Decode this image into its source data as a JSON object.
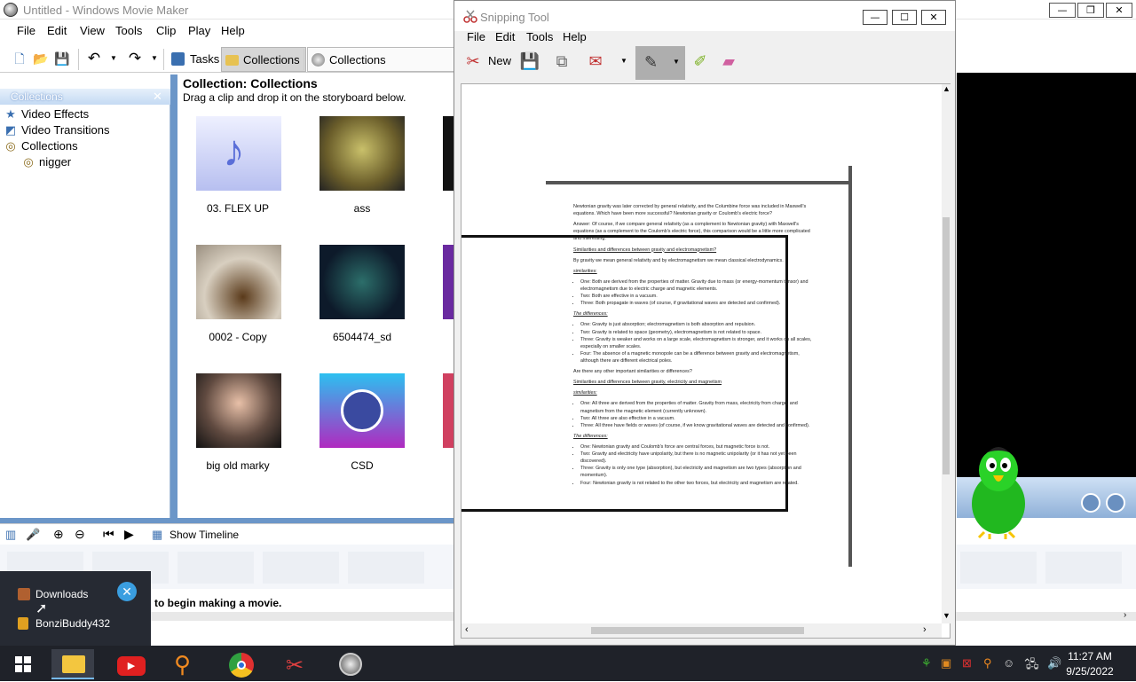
{
  "movie_maker": {
    "title": "Untitled - Windows Movie Maker",
    "menu": [
      "File",
      "Edit",
      "View",
      "Tools",
      "Clip",
      "Play",
      "Help"
    ],
    "toolbar": {
      "tasks": "Tasks",
      "collections": "Collections",
      "collections_dropdown": "Collections"
    },
    "panel_title": "Collections",
    "tree": [
      {
        "label": "Video Effects",
        "icon": "star-icon"
      },
      {
        "label": "Video Transitions",
        "icon": "transition-icon"
      },
      {
        "label": "Collections",
        "icon": "film-icon"
      },
      {
        "label": "nigger",
        "icon": "film-icon"
      }
    ],
    "collection_title": "Collection: Collections",
    "collection_subtitle": "Drag a clip and drop it on the storyboard below.",
    "clips": [
      {
        "label": "03. FLEX UP"
      },
      {
        "label": "ass"
      },
      {
        "label": "0002 - Copy"
      },
      {
        "label": "6504474_sd"
      },
      {
        "label": "big old marky"
      },
      {
        "label": "CSD"
      }
    ],
    "show_timeline": "Show Timeline",
    "storyboard_hint": "to begin making a movie."
  },
  "snipping_tool": {
    "title": "Snipping Tool",
    "menu": [
      "File",
      "Edit",
      "Tools",
      "Help"
    ],
    "new_label": "New",
    "doc": {
      "p1": "Newtonian gravity was later corrected by general relativity, and the Columbine force was included in Maxwell's equations. Which have been more successful? Newtonian gravity or Coulomb's electric force?",
      "p2": "Answer: Of course, if we compare general relativity (as a complement to Newtonian gravity) with Maxwell's equations (as a complement to the Coulomb's electric force), this comparison would be a little more complicated and interesting.",
      "h1": "Similarities and differences between gravity and electromagnetism?",
      "p3": "By gravity we mean general relativity and by electromagnetism we mean classical electrodynamics.",
      "h2": "similarities:",
      "s1": "One: Both are derived from the properties of matter. Gravity due to mass (or energy-momentum tensor) and electromagnetism due to electric charge and magnetic elements.",
      "s2": "Two: Both are effective in a vacuum.",
      "s3": "Three: Both propagate in waves (of course, if gravitational waves are detected and confirmed).",
      "h3": "The differences:",
      "d1": "One: Gravity is just absorption; electromagnetism is both absorption and repulsion.",
      "d2": "Two: Gravity is related to space (geometry), electromagnetism is not related to space.",
      "d3": "Three: Gravity is weaker and works on a large scale, electromagnetism is stronger, and it works on all scales, especially on smaller scales.",
      "d4": "Four: The absence of a magnetic monopole can be a difference between gravity and electromagnetism, although there are different electrical poles.",
      "p4": "Are there any other important similarities or differences?",
      "h4": "Similarities and differences between gravity, electricity and magnetism",
      "h5": "similarities:",
      "t1": "One: All three are derived from the properties of matter. Gravity from mass, electricity from charge, and magnetism from the magnetic element (currently unknown).",
      "t2": "Two: All three are also effective in a vacuum.",
      "t3": "Three: All three have fields or waves (of course, if we know gravitational waves are detected and confirmed).",
      "h6": "The differences:",
      "e1": "One: Newtonian gravity and Coulomb's force are central forces, but magnetic force is not.",
      "e2": "Two: Gravity and electricity have unipolarity, but there is no magnetic unipolarity (or it has not yet been discovered).",
      "e3": "Three: Gravity is only one type (absorption), but electricity and magnetism are two types (absorption and momentum).",
      "e4": "Four: Newtonian gravity is not related to the other two forces, but electricity and magnetism are related."
    }
  },
  "jumplist": [
    {
      "label": "Downloads"
    },
    {
      "label": "BonziBuddy432"
    }
  ],
  "taskbar": {
    "time": "11:27 AM",
    "date": "9/25/2022"
  }
}
